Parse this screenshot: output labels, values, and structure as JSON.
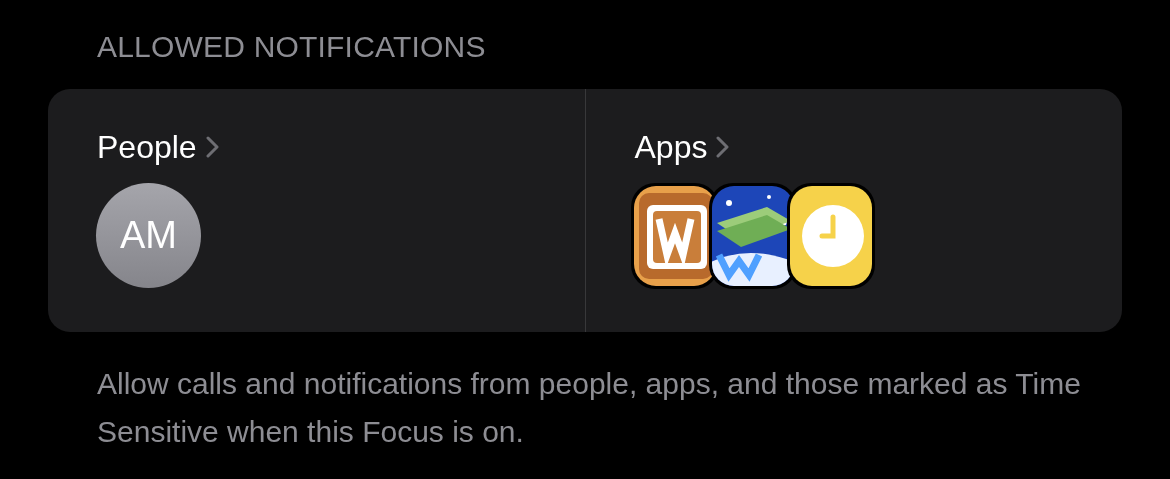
{
  "heading": "ALLOWED NOTIFICATIONS",
  "sections": [
    {
      "kind": "people",
      "label": "People",
      "avatars": [
        {
          "initials": "AM"
        }
      ]
    },
    {
      "kind": "apps",
      "label": "Apps",
      "apps": [
        {
          "kind": "cookie"
        },
        {
          "kind": "money"
        },
        {
          "kind": "clock"
        }
      ]
    }
  ],
  "footer": "Allow calls and notifications from people, apps, and those marked as Time Sensitive when this Focus is on."
}
